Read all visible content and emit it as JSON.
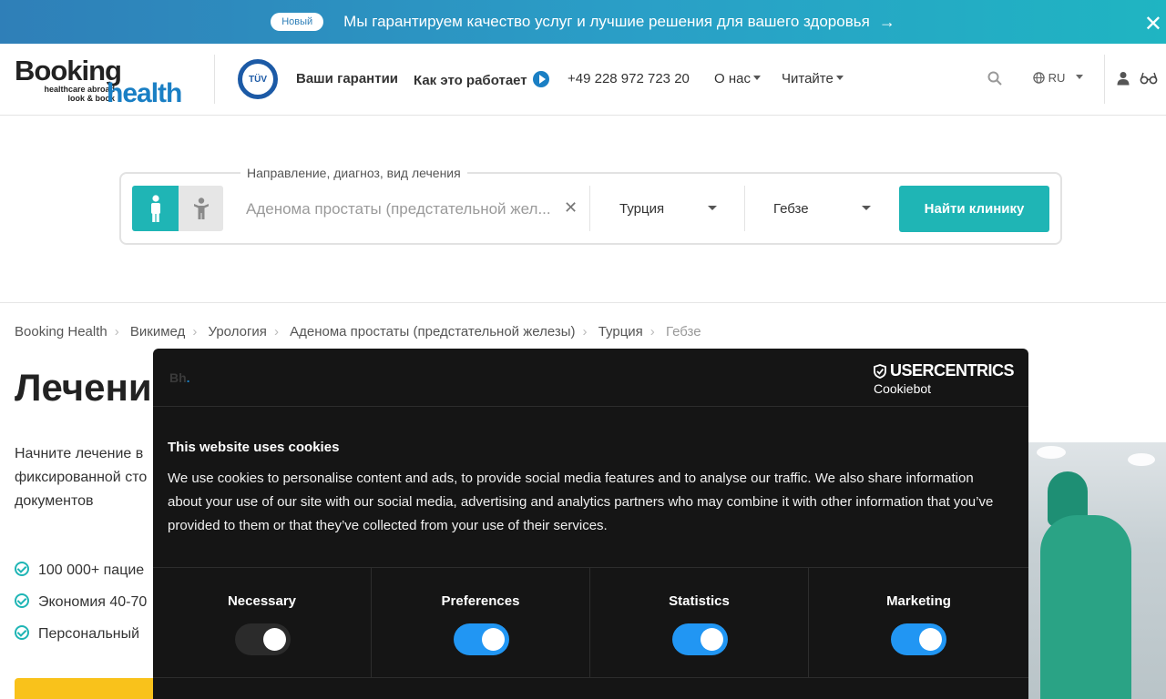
{
  "banner": {
    "badge": "Новый",
    "message": "Мы гарантируем качество услуг и лучшие решения для вашего здоровья",
    "arrow": "→",
    "close": "✕"
  },
  "header": {
    "logo": {
      "line1": "Booking",
      "line2": "healthcare abroad",
      "line3": "look & book",
      "line4": "health"
    },
    "tuv_label": "TÜV",
    "nav": {
      "guarantees": "Ваши гарантии",
      "how_it_works": "Как это работает",
      "phone": "+49 228 972 723 20",
      "about": "О нас",
      "read": "Читайте"
    },
    "lang": "RU",
    "icons": [
      "search-icon",
      "globe-icon",
      "user-icon",
      "glasses-icon",
      "play-icon"
    ]
  },
  "search": {
    "legend": "Направление, диагноз, вид лечения",
    "diagnosis_value": "Аденома простаты (предстательной жел...",
    "country": "Турция",
    "city": "Гебзе",
    "button": "Найти клинику"
  },
  "breadcrumbs": [
    "Booking Health",
    "Викимед",
    "Урология",
    "Аденома простаты (предстательной железы)",
    "Турция",
    "Гебзе"
  ],
  "page": {
    "title": "Лечени",
    "lead": [
      "Начните лечение в",
      "фиксированной сто",
      "документов"
    ],
    "bullets": [
      "100 000+ пацие",
      "Экономия 40-70",
      "Персональный"
    ]
  },
  "cookie": {
    "brand_mark": "Bh",
    "brand_dot": ".",
    "brand_name": "USERCENTRICS",
    "brand_sub": "Cookiebot",
    "title": "This website uses cookies",
    "text": "We use cookies to personalise content and ads, to provide social media features and to analyse our traffic. We also share information about your use of our site with our social media, advertising and analytics partners who may combine it with other information that you’ve provided to them or that they’ve collected from your use of their services.",
    "categories": [
      {
        "label": "Necessary",
        "enabled": true,
        "disabled_style": true
      },
      {
        "label": "Preferences",
        "enabled": true
      },
      {
        "label": "Statistics",
        "enabled": true
      },
      {
        "label": "Marketing",
        "enabled": true
      }
    ],
    "colors": {
      "toggle_on": "#2196f3",
      "background": "#151515"
    }
  },
  "colors": {
    "teal": "#1fb5b5",
    "brand_blue": "#1a7fc4",
    "yellow": "#f9c21b"
  }
}
